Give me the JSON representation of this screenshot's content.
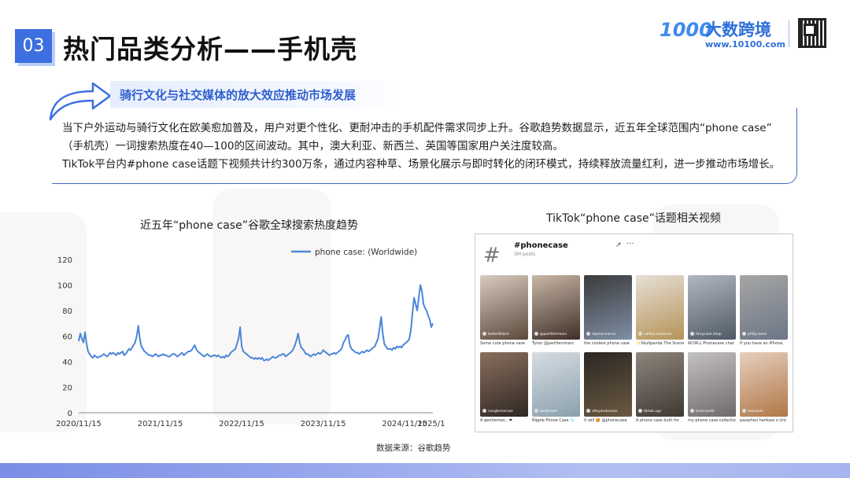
{
  "header": {
    "section_number": "03",
    "title": "热门品类分析——手机壳"
  },
  "logo": {
    "mark": "1000",
    "name": "大数跨境",
    "url": "www.10100.com"
  },
  "subheading": "骑行文化与社交媒体的放大效应推动市场发展",
  "description": [
    "当下户外运动与骑行文化在欧美愈加普及，用户对更个性化、更耐冲击的手机配件需求同步上升。谷歌趋势数据显示，近五年全球范围内“phone case”",
    "（手机壳）一词搜索热度在40—100的区间波动。其中，澳大利亚、新西兰、英国等国家用户关注度较高。",
    "TikTok平台内#phone case话题下视频共计约300万条，通过内容种草、场景化展示与即时转化的闭环模式，持续释放流量红利，进一步推动市场增长。"
  ],
  "chart_title": "近五年“phone case”谷歌全球搜索热度趋势",
  "source": "数据来源：谷歌趋势",
  "chart_data": {
    "type": "line",
    "title": "近五年“phone case”谷歌全球搜索热度趋势",
    "xlabel": "",
    "ylabel": "",
    "ylim": [
      0,
      120
    ],
    "yticks": [
      0,
      20,
      40,
      60,
      80,
      100,
      120
    ],
    "xtick_labels": [
      "2020/11/15",
      "2021/11/15",
      "2022/11/15",
      "2023/11/15",
      "2024/11/15",
      "2025/1"
    ],
    "grid": false,
    "legend": "top-center",
    "color": "#4a86d9",
    "series": [
      {
        "name": "phone case: (Worldwide)",
        "x_start": "2020/11/15",
        "x_step": "week",
        "values": [
          56,
          62,
          58,
          55,
          63,
          54,
          48,
          46,
          44,
          43,
          45,
          44,
          43,
          44,
          44,
          45,
          46,
          45,
          44,
          45,
          47,
          46,
          47,
          46,
          45,
          47,
          46,
          47,
          48,
          45,
          46,
          48,
          50,
          49,
          51,
          53,
          55,
          60,
          68,
          58,
          52,
          50,
          48,
          47,
          46,
          45,
          45,
          44,
          45,
          46,
          45,
          44,
          45,
          45,
          46,
          45,
          45,
          44,
          44,
          45,
          46,
          46,
          45,
          44,
          45,
          46,
          47,
          45,
          46,
          47,
          48,
          48,
          49,
          51,
          53,
          50,
          48,
          47,
          46,
          45,
          44,
          45,
          46,
          45,
          44,
          44,
          45,
          45,
          44,
          45,
          44,
          43,
          44,
          43,
          45,
          44,
          45,
          47,
          48,
          49,
          50,
          54,
          58,
          67,
          52,
          48,
          47,
          46,
          45,
          44,
          43,
          43,
          42,
          43,
          42,
          43,
          42,
          43,
          41,
          41,
          42,
          41,
          42,
          43,
          44,
          43,
          43,
          44,
          45,
          45,
          46,
          46,
          44,
          45,
          46,
          47,
          48,
          50,
          53,
          57,
          62,
          55,
          51,
          50,
          48,
          46,
          46,
          45,
          44,
          45,
          46,
          45,
          46,
          47,
          46,
          47,
          49,
          48,
          47,
          46,
          45,
          46,
          46,
          47,
          46,
          47,
          48,
          49,
          51,
          55,
          57,
          60,
          61,
          53,
          50,
          49,
          48,
          47,
          47,
          46,
          47,
          48,
          47,
          48,
          49,
          48,
          49,
          50,
          51,
          52,
          55,
          58,
          66,
          75,
          62,
          54,
          52,
          50,
          50,
          50,
          49,
          51,
          50,
          52,
          51,
          52,
          51,
          53,
          54,
          55,
          56,
          58,
          65,
          78,
          90,
          85,
          80,
          90,
          100,
          95,
          85,
          82,
          80,
          76,
          73,
          67,
          70
        ]
      }
    ]
  },
  "tiktok": {
    "title": "TikTok“phone case”话题相关视频",
    "hashtag": "#phonecase",
    "posts": "3M posts",
    "hash_icon": "#",
    "share_icon": "↗",
    "more_icon": "···",
    "videos": [
      {
        "user": "bellerthlach",
        "caption": "Some cute phone case",
        "color_top": "#d9cbbf",
        "color_bottom": "#5b4a3c"
      },
      {
        "user": "@partiterrmarc",
        "caption": "Tyron @partiterrmarc",
        "color_top": "#c9b7a6",
        "color_bottom": "#3e2f28"
      },
      {
        "user": "alyssanvacco",
        "caption": "the coolest phone case",
        "color_top": "#3a3a3a",
        "color_bottom": "#7f8fa5"
      },
      {
        "user": "caidus.aviatoris",
        "caption": "✨Skullpanda The Scene",
        "color_top": "#e6dfd7",
        "color_bottom": "#b59357"
      },
      {
        "user": "fairycase.shop",
        "caption": "W.OR.L Phonecase chat",
        "color_top": "#b1b7bf",
        "color_bottom": "#4f5a66"
      },
      {
        "user": "phitycases",
        "caption": "If you have an iPhone,",
        "color_top": "#a6a6a4",
        "color_bottom": "#6c7687"
      },
      {
        "user": "conglomerase",
        "caption": "A gentleman...❤",
        "color_top": "#8a6f5e",
        "color_bottom": "#2f2723"
      },
      {
        "user": "kaelterart",
        "caption": "Ripple Phone Case 🫧",
        "color_top": "#d7dde3",
        "color_bottom": "#8aa0ad"
      },
      {
        "user": "alloyandvenus",
        "caption": "it will 🤩 @phonecase",
        "color_top": "#2b2623",
        "color_bottom": "#6b5a41"
      },
      {
        "user": "tiktok.ugc",
        "caption": "A phone case built for",
        "color_top": "#8e857c",
        "color_bottom": "#3f3933"
      },
      {
        "user": "lovecasekl",
        "caption": "my phone case collection",
        "color_top": "#c4c1c2",
        "color_bottom": "#6e6a6b"
      },
      {
        "user": "fuecases",
        "caption": "pazartesi harikasi o ürü",
        "color_top": "#e6cfbd",
        "color_bottom": "#b07748"
      }
    ]
  }
}
